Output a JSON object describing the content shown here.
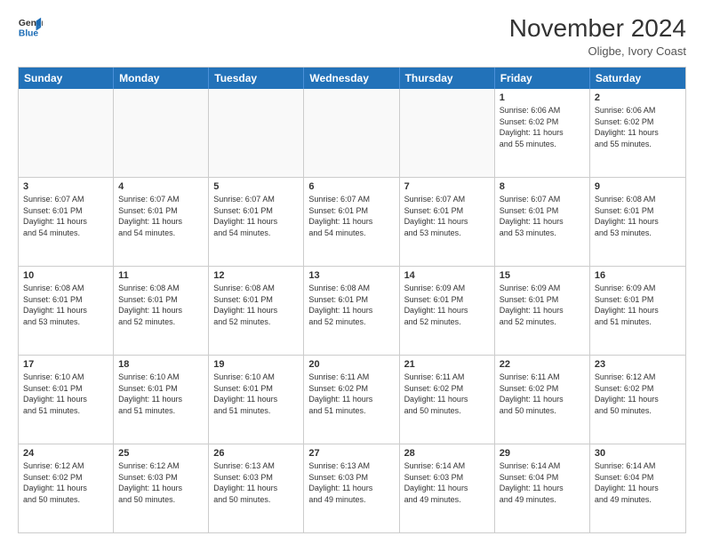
{
  "header": {
    "logo_line1": "General",
    "logo_line2": "Blue",
    "month": "November 2024",
    "location": "Oligbe, Ivory Coast"
  },
  "weekdays": [
    "Sunday",
    "Monday",
    "Tuesday",
    "Wednesday",
    "Thursday",
    "Friday",
    "Saturday"
  ],
  "rows": [
    [
      {
        "day": "",
        "info": ""
      },
      {
        "day": "",
        "info": ""
      },
      {
        "day": "",
        "info": ""
      },
      {
        "day": "",
        "info": ""
      },
      {
        "day": "",
        "info": ""
      },
      {
        "day": "1",
        "info": "Sunrise: 6:06 AM\nSunset: 6:02 PM\nDaylight: 11 hours\nand 55 minutes."
      },
      {
        "day": "2",
        "info": "Sunrise: 6:06 AM\nSunset: 6:02 PM\nDaylight: 11 hours\nand 55 minutes."
      }
    ],
    [
      {
        "day": "3",
        "info": "Sunrise: 6:07 AM\nSunset: 6:01 PM\nDaylight: 11 hours\nand 54 minutes."
      },
      {
        "day": "4",
        "info": "Sunrise: 6:07 AM\nSunset: 6:01 PM\nDaylight: 11 hours\nand 54 minutes."
      },
      {
        "day": "5",
        "info": "Sunrise: 6:07 AM\nSunset: 6:01 PM\nDaylight: 11 hours\nand 54 minutes."
      },
      {
        "day": "6",
        "info": "Sunrise: 6:07 AM\nSunset: 6:01 PM\nDaylight: 11 hours\nand 54 minutes."
      },
      {
        "day": "7",
        "info": "Sunrise: 6:07 AM\nSunset: 6:01 PM\nDaylight: 11 hours\nand 53 minutes."
      },
      {
        "day": "8",
        "info": "Sunrise: 6:07 AM\nSunset: 6:01 PM\nDaylight: 11 hours\nand 53 minutes."
      },
      {
        "day": "9",
        "info": "Sunrise: 6:08 AM\nSunset: 6:01 PM\nDaylight: 11 hours\nand 53 minutes."
      }
    ],
    [
      {
        "day": "10",
        "info": "Sunrise: 6:08 AM\nSunset: 6:01 PM\nDaylight: 11 hours\nand 53 minutes."
      },
      {
        "day": "11",
        "info": "Sunrise: 6:08 AM\nSunset: 6:01 PM\nDaylight: 11 hours\nand 52 minutes."
      },
      {
        "day": "12",
        "info": "Sunrise: 6:08 AM\nSunset: 6:01 PM\nDaylight: 11 hours\nand 52 minutes."
      },
      {
        "day": "13",
        "info": "Sunrise: 6:08 AM\nSunset: 6:01 PM\nDaylight: 11 hours\nand 52 minutes."
      },
      {
        "day": "14",
        "info": "Sunrise: 6:09 AM\nSunset: 6:01 PM\nDaylight: 11 hours\nand 52 minutes."
      },
      {
        "day": "15",
        "info": "Sunrise: 6:09 AM\nSunset: 6:01 PM\nDaylight: 11 hours\nand 52 minutes."
      },
      {
        "day": "16",
        "info": "Sunrise: 6:09 AM\nSunset: 6:01 PM\nDaylight: 11 hours\nand 51 minutes."
      }
    ],
    [
      {
        "day": "17",
        "info": "Sunrise: 6:10 AM\nSunset: 6:01 PM\nDaylight: 11 hours\nand 51 minutes."
      },
      {
        "day": "18",
        "info": "Sunrise: 6:10 AM\nSunset: 6:01 PM\nDaylight: 11 hours\nand 51 minutes."
      },
      {
        "day": "19",
        "info": "Sunrise: 6:10 AM\nSunset: 6:01 PM\nDaylight: 11 hours\nand 51 minutes."
      },
      {
        "day": "20",
        "info": "Sunrise: 6:11 AM\nSunset: 6:02 PM\nDaylight: 11 hours\nand 51 minutes."
      },
      {
        "day": "21",
        "info": "Sunrise: 6:11 AM\nSunset: 6:02 PM\nDaylight: 11 hours\nand 50 minutes."
      },
      {
        "day": "22",
        "info": "Sunrise: 6:11 AM\nSunset: 6:02 PM\nDaylight: 11 hours\nand 50 minutes."
      },
      {
        "day": "23",
        "info": "Sunrise: 6:12 AM\nSunset: 6:02 PM\nDaylight: 11 hours\nand 50 minutes."
      }
    ],
    [
      {
        "day": "24",
        "info": "Sunrise: 6:12 AM\nSunset: 6:02 PM\nDaylight: 11 hours\nand 50 minutes."
      },
      {
        "day": "25",
        "info": "Sunrise: 6:12 AM\nSunset: 6:03 PM\nDaylight: 11 hours\nand 50 minutes."
      },
      {
        "day": "26",
        "info": "Sunrise: 6:13 AM\nSunset: 6:03 PM\nDaylight: 11 hours\nand 50 minutes."
      },
      {
        "day": "27",
        "info": "Sunrise: 6:13 AM\nSunset: 6:03 PM\nDaylight: 11 hours\nand 49 minutes."
      },
      {
        "day": "28",
        "info": "Sunrise: 6:14 AM\nSunset: 6:03 PM\nDaylight: 11 hours\nand 49 minutes."
      },
      {
        "day": "29",
        "info": "Sunrise: 6:14 AM\nSunset: 6:04 PM\nDaylight: 11 hours\nand 49 minutes."
      },
      {
        "day": "30",
        "info": "Sunrise: 6:14 AM\nSunset: 6:04 PM\nDaylight: 11 hours\nand 49 minutes."
      }
    ]
  ]
}
